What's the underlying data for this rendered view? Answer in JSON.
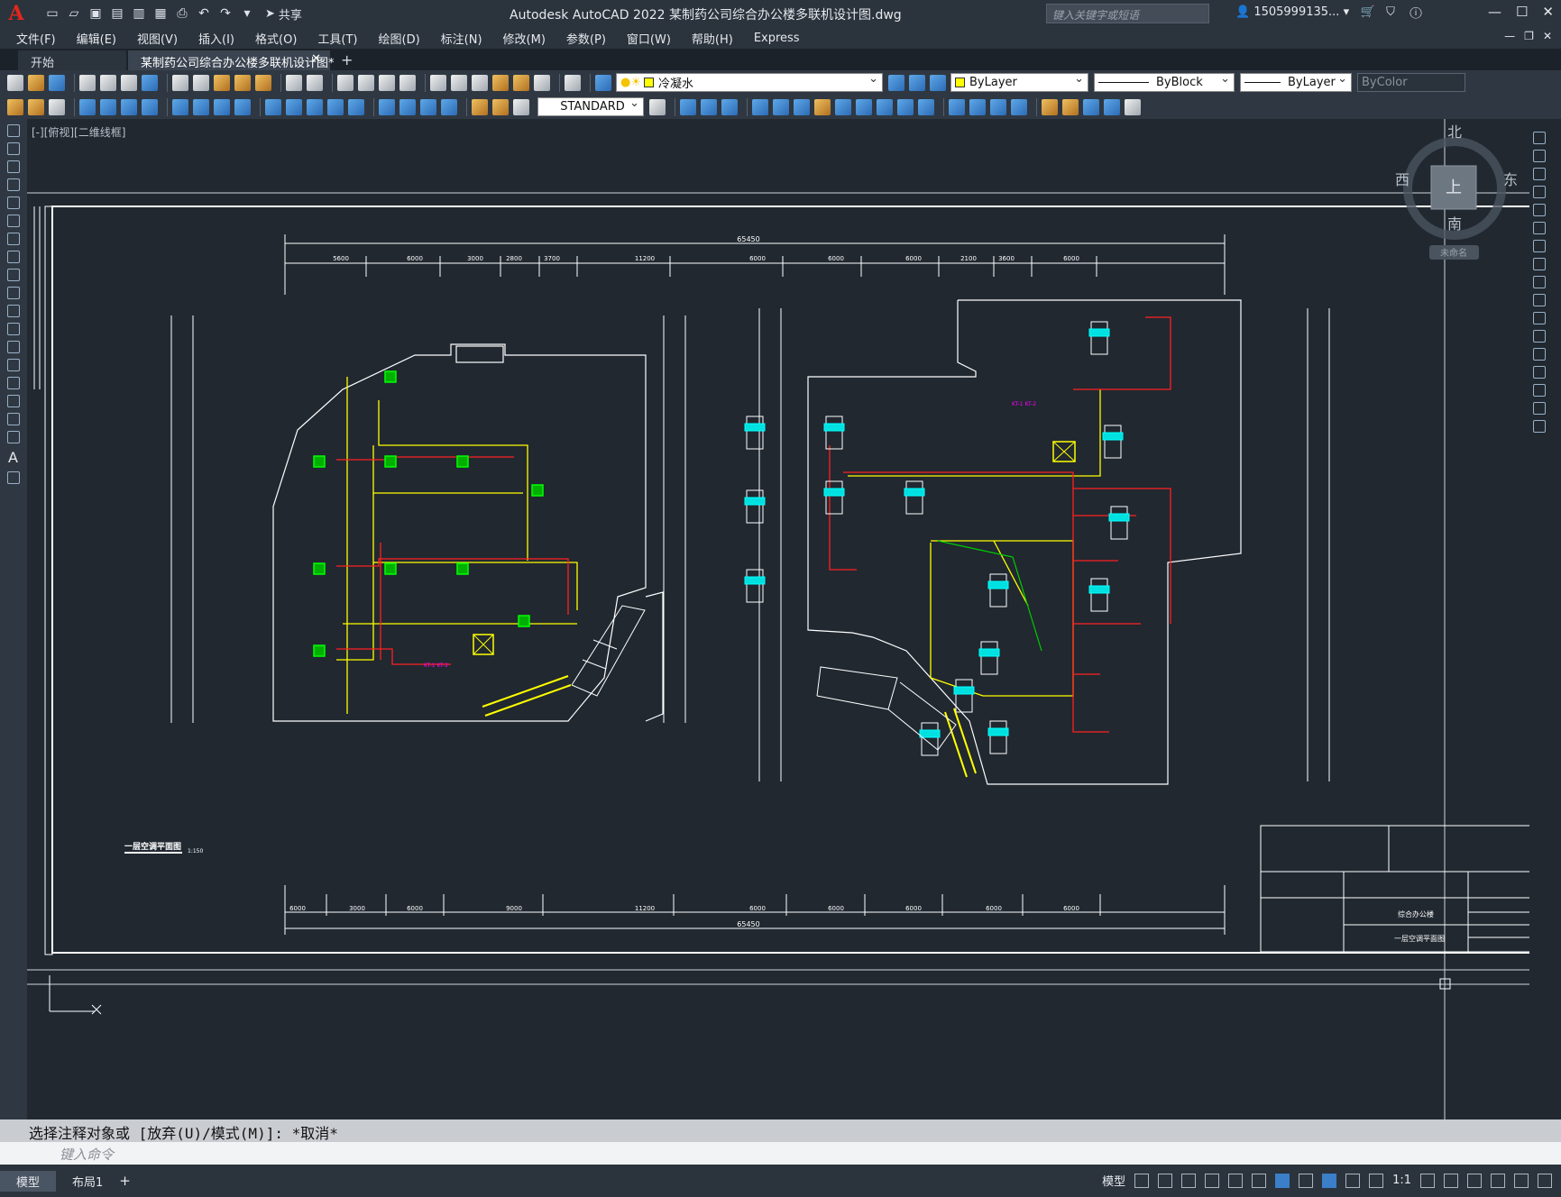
{
  "app": {
    "title": "Autodesk AutoCAD 2022    某制药公司综合办公楼多联机设计图.dwg",
    "share_label": "共享",
    "search_placeholder": "键入关键字或短语",
    "user_name": "1505999135...",
    "logo_letter": "A"
  },
  "menu": [
    "文件(F)",
    "编辑(E)",
    "视图(V)",
    "插入(I)",
    "格式(O)",
    "工具(T)",
    "绘图(D)",
    "标注(N)",
    "修改(M)",
    "参数(P)",
    "窗口(W)",
    "帮助(H)",
    "Express"
  ],
  "tabs": [
    {
      "label": "开始"
    },
    {
      "label": "某制药公司综合办公楼多联机设计图*"
    }
  ],
  "toolbar": {
    "layer_name": "冷凝水",
    "color": "ByLayer",
    "linetype": "ByBlock",
    "lineweight": "ByLayer",
    "plotstyle": "ByColor",
    "textstyle": "STANDARD"
  },
  "viewport_label": "[-][俯视][二维线框]",
  "viewcube": {
    "north": "北",
    "south": "南",
    "east": "东",
    "west": "西",
    "top": "上",
    "wcs": "未命名"
  },
  "drawing": {
    "overall_dim": "65450",
    "top_dims": [
      "5600",
      "6000",
      "3000",
      "2800",
      "3700",
      "11200",
      "6000",
      "6000",
      "6000",
      "2100",
      "3600",
      "6000"
    ],
    "bottom_dims": [
      "6000",
      "3000",
      "6000",
      "9000",
      "11200",
      "6000",
      "6000",
      "6000",
      "6000",
      "6000"
    ],
    "plan_title": "一层空调平面图",
    "plan_scale": "1:150",
    "title_block_building": "综合办公楼",
    "title_block_drawing": "一层空调平面图",
    "colors": {
      "bg": "#212830",
      "green": "#00ff00",
      "yellow": "#ffff00",
      "red": "#ff2020",
      "cyan": "#00ffff",
      "magenta": "#ff00ff",
      "white": "#ffffff"
    }
  },
  "command": {
    "history": "选择注释对象或 [放弃(U)/模式(M)]: *取消*",
    "placeholder": "键入命令"
  },
  "layout_tabs": [
    "模型",
    "布局1"
  ],
  "status": {
    "model": "模型",
    "scale": "1:1"
  }
}
